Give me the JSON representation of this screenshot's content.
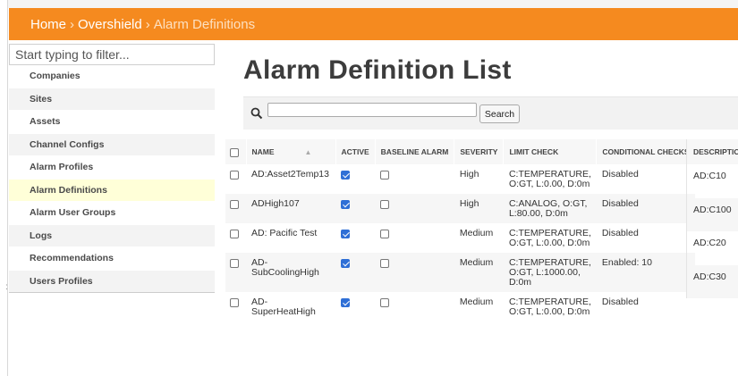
{
  "breadcrumb": {
    "home": "Home",
    "separator": "›",
    "section": "Overshield",
    "current": "Alarm Definitions"
  },
  "sidebar": {
    "filter_placeholder": "Start typing to filter...",
    "items": [
      {
        "label": "Companies"
      },
      {
        "label": "Sites"
      },
      {
        "label": "Assets"
      },
      {
        "label": "Channel Configs"
      },
      {
        "label": "Alarm Profiles"
      },
      {
        "label": "Alarm Definitions",
        "active": true
      },
      {
        "label": "Alarm User Groups"
      },
      {
        "label": "Logs"
      },
      {
        "label": "Recommendations"
      },
      {
        "label": "Users Profiles"
      }
    ],
    "edge_marker": ":"
  },
  "page": {
    "title": "Alarm Definition List"
  },
  "search": {
    "button_label": "Search",
    "value": ""
  },
  "table": {
    "headers": {
      "name": "NAME",
      "active": "ACTIVE",
      "baseline": "BASELINE ALARM",
      "severity": "SEVERITY",
      "limit": "LIMIT CHECK",
      "conditional": "CONDITIONAL CHECKS",
      "description": "DESCRIPTION"
    },
    "rows": [
      {
        "name": "AD:Asset2Temp13",
        "active": true,
        "baseline": false,
        "severity": "High",
        "limit": "C:TEMPERATURE, O:GT, L:0.00, D:0m",
        "conditional": "Disabled"
      },
      {
        "name": "ADHigh107",
        "active": true,
        "baseline": false,
        "severity": "High",
        "limit": "C:ANALOG, O:GT, L:80.00, D:0m",
        "conditional": "Disabled"
      },
      {
        "name": "AD: Pacific Test",
        "active": true,
        "baseline": false,
        "severity": "Medium",
        "limit": "C:TEMPERATURE, O:GT, L:0.00, D:0m",
        "conditional": "Disabled"
      },
      {
        "name": "AD-SubCoolingHigh",
        "active": true,
        "baseline": false,
        "severity": "Medium",
        "limit": "C:TEMPERATURE, O:GT, L:1000.00, D:0m",
        "conditional": "Enabled: 10"
      },
      {
        "name": "AD-SuperHeatHigh",
        "active": true,
        "baseline": false,
        "severity": "Medium",
        "limit": "C:TEMPERATURE, O:GT, L:0.00, D:0m",
        "conditional": "Disabled"
      }
    ],
    "descriptions": [
      "AD:C10",
      "AD:C100",
      "AD:C20",
      "AD:C30"
    ]
  },
  "colors": {
    "topbar": "#f58a1f",
    "active_nav": "#ffffd8",
    "checkbox_on": "#2f6fd6"
  },
  "icons": {
    "search": "search-icon",
    "sort": "sort-up-icon"
  }
}
